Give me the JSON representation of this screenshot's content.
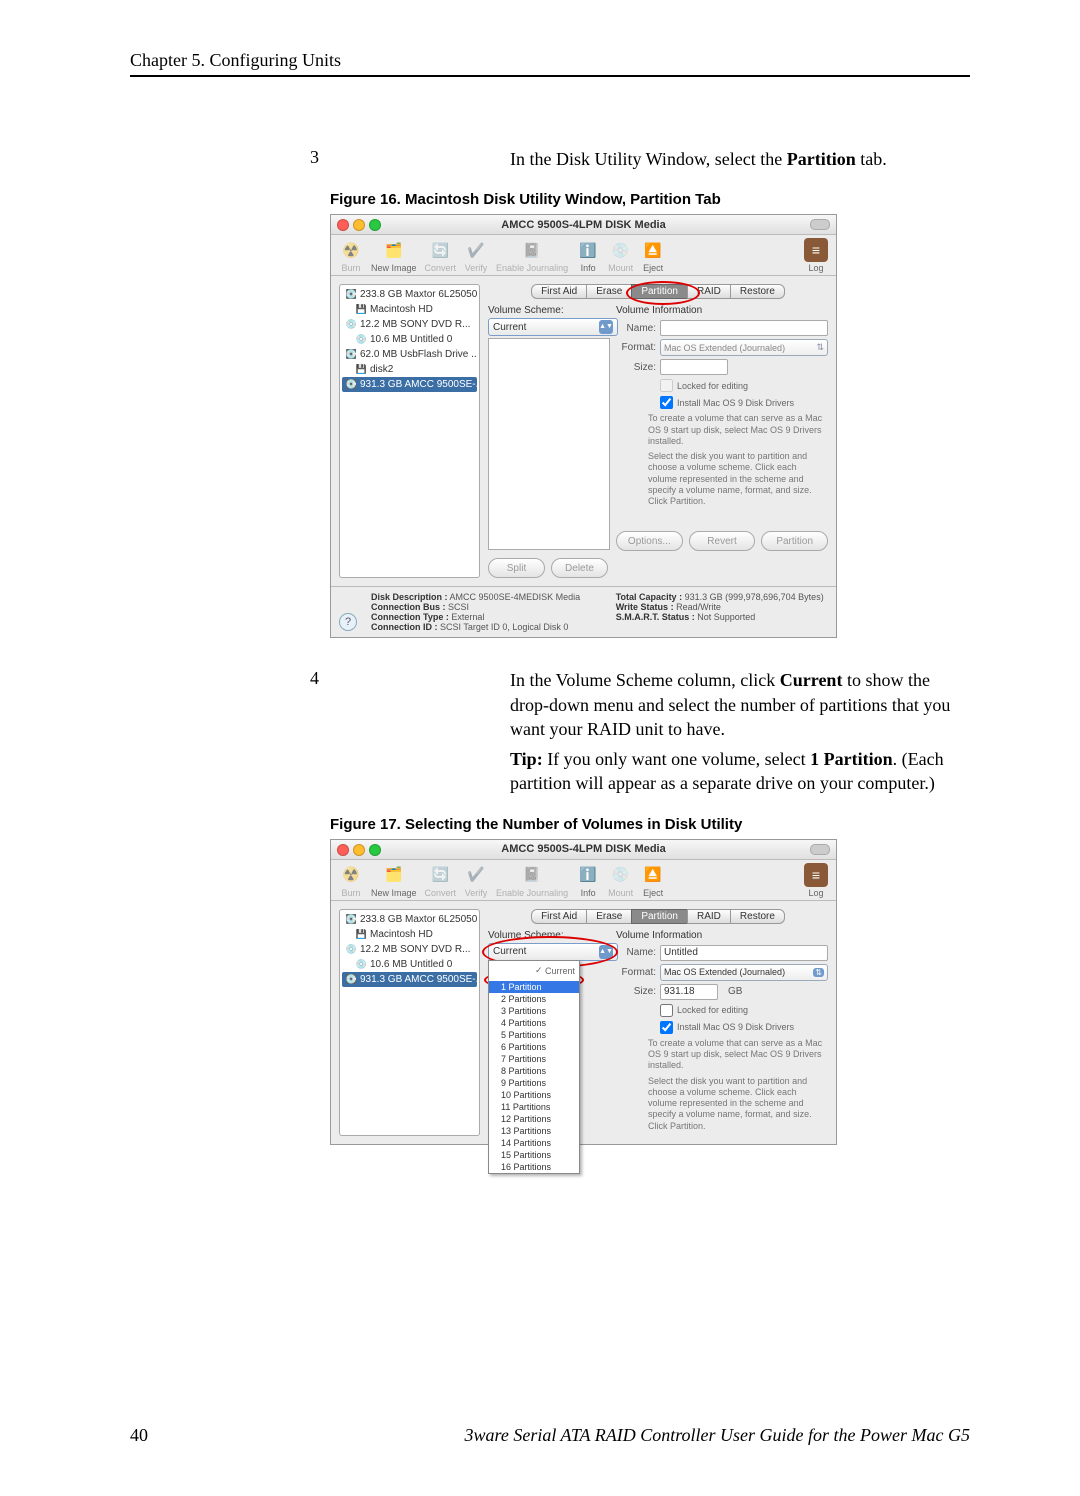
{
  "chapter_header": "Chapter 5. Configuring Units",
  "step3_num": "3",
  "step3_text_a": "In the Disk Utility Window, select the ",
  "step3_bold": "Partition",
  "step3_text_b": " tab.",
  "figure16_caption": "Figure 16.   Macintosh Disk Utility Window, Partition Tab",
  "step4_num": "4",
  "step4_text_a": "In the Volume Scheme column, click ",
  "step4_bold": "Current",
  "step4_text_b": " to show the drop-down menu and select the number of partitions that you want your RAID unit to have.",
  "tip_a": "Tip:",
  "tip_b": " If you only want one volume, select ",
  "tip_bold": "1 Partition",
  "tip_c": ". (Each partition will appear as a separate drive on your computer.)",
  "figure17_caption": "Figure 17.   Selecting the Number of Volumes in Disk Utility",
  "page_number": "40",
  "footer_title": "3ware Serial ATA RAID Controller User Guide for the Power Mac G5",
  "window": {
    "title": "AMCC 9500S-4LPM DISK Media",
    "toolbar": {
      "burn": "Burn",
      "new_image": "New Image",
      "convert": "Convert",
      "verify": "Verify",
      "enable_journaling": "Enable Journaling",
      "info": "Info",
      "mount": "Mount",
      "eject": "Eject",
      "log": "Log"
    },
    "sidebar_fig16": [
      "233.8 GB Maxtor 6L25050",
      "Macintosh HD",
      "12.2 MB SONY   DVD R...",
      "10.6 MB Untitled 0",
      "62.0 MB UsbFlash Drive ...",
      "disk2",
      "931.3 GB AMCC 9500SE-..."
    ],
    "sidebar_fig17": [
      "233.8 GB Maxtor 6L25050",
      "Macintosh HD",
      "12.2 MB SONY   DVD R...",
      "10.6 MB Untitled 0",
      "931.3 GB AMCC 9500SE-..."
    ],
    "tabs": [
      "First Aid",
      "Erase",
      "Partition",
      "RAID",
      "Restore"
    ],
    "volume_scheme_label": "Volume Scheme:",
    "current": "Current",
    "volume_info_label": "Volume Information",
    "name_label": "Name:",
    "format_label": "Format:",
    "size_label": "Size:",
    "format_value": "Mac OS Extended (Journaled)",
    "name_value": "Untitled",
    "size_value": "931.18",
    "size_unit": "GB",
    "locked_for_editing": "Locked for editing",
    "install_drivers": "Install Mac OS 9 Disk Drivers",
    "note_os9": "To create a volume that can serve as a Mac OS 9 start up disk, select Mac OS 9 Drivers installed.",
    "note_partition": "Select the disk you want to partition and choose a volume scheme. Click each volume represented in the scheme and specify a volume name, format, and size. Click Partition.",
    "buttons": {
      "split": "Split",
      "delete": "Delete",
      "options": "Options...",
      "revert": "Revert",
      "partition": "Partition"
    },
    "partition_options": [
      "Current",
      "1 Partition",
      "2 Partitions",
      "3 Partitions",
      "4 Partitions",
      "5 Partitions",
      "6 Partitions",
      "7 Partitions",
      "8 Partitions",
      "9 Partitions",
      "10 Partitions",
      "11 Partitions",
      "12 Partitions",
      "13 Partitions",
      "14 Partitions",
      "15 Partitions",
      "16 Partitions"
    ],
    "footer_info": {
      "disk_desc_l": "Disk Description :",
      "disk_desc_v": "AMCC 9500SE-4MEDISK Media",
      "conn_bus_l": "Connection Bus :",
      "conn_bus_v": "SCSI",
      "conn_type_l": "Connection Type :",
      "conn_type_v": "External",
      "conn_id_l": "Connection ID :",
      "conn_id_v": "SCSI Target ID 0, Logical Disk 0",
      "total_cap_l": "Total Capacity :",
      "total_cap_v": "931.3 GB (999,978,696,704 Bytes)",
      "write_status_l": "Write Status :",
      "write_status_v": "Read/Write",
      "smart_l": "S.M.A.R.T. Status :",
      "smart_v": "Not Supported"
    }
  }
}
